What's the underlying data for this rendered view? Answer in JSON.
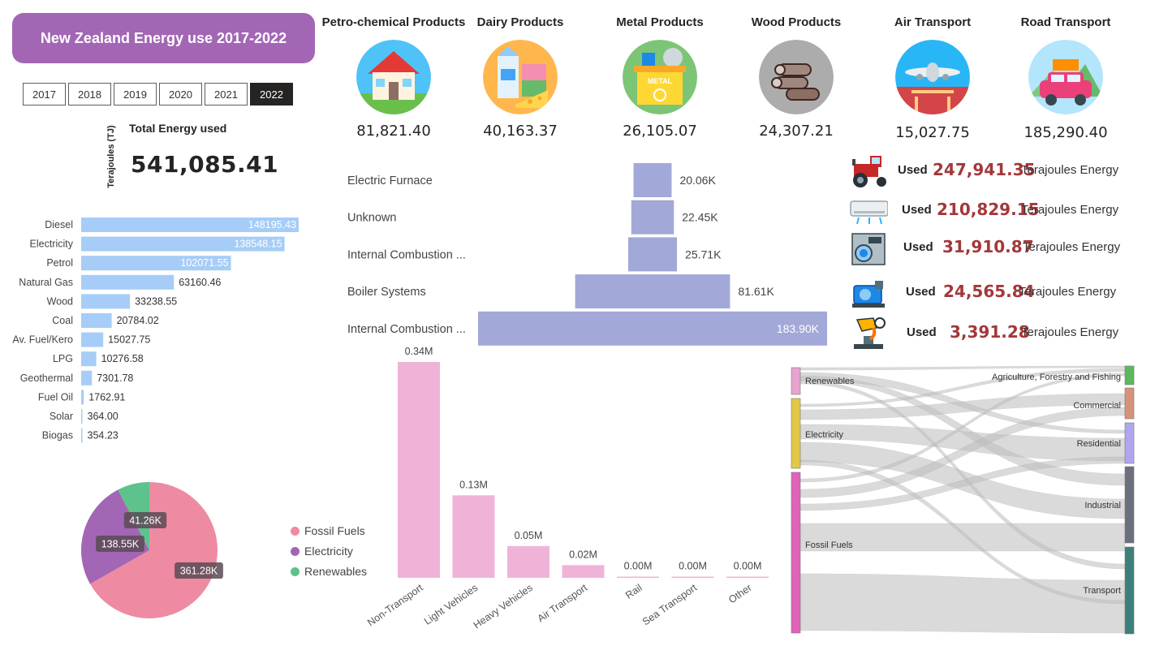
{
  "header": {
    "title": "New Zealand Energy use 2017-2022"
  },
  "years": {
    "items": [
      "2017",
      "2018",
      "2019",
      "2020",
      "2021",
      "2022"
    ],
    "selected": "2022"
  },
  "kpi": {
    "axis_label": "Terajoules (TJ)",
    "title": "Total Energy used",
    "value": "541,085.41"
  },
  "products": [
    {
      "title": "Petro-chemical Products",
      "value": "81,821.40",
      "icon": "house-icon"
    },
    {
      "title": "Dairy Products",
      "value": "40,163.37",
      "icon": "milk-cheese-icon"
    },
    {
      "title": "Metal Products",
      "value": "26,105.07",
      "icon": "metal-recycle-bin-icon"
    },
    {
      "title": "Wood Products",
      "value": "24,307.21",
      "icon": "logs-icon"
    },
    {
      "title": "Air Transport",
      "value": "15,027.75",
      "icon": "airplane-icon"
    },
    {
      "title": "Road Transport",
      "value": "185,290.40",
      "icon": "car-icon"
    }
  ],
  "used": [
    {
      "label": "Used",
      "value": "247,941.35",
      "tail": "Terajoules Energy",
      "icon": "tractor-icon"
    },
    {
      "label": "Used",
      "value": "210,829.15",
      "tail": "Terajoules Energy",
      "icon": "air-conditioner-icon"
    },
    {
      "label": "Used",
      "value": "31,910.87",
      "tail": "Terajoules Energy",
      "icon": "washing-machine-icon"
    },
    {
      "label": "Used",
      "value": "24,565.84",
      "tail": "Terajoules Energy",
      "icon": "generator-icon"
    },
    {
      "label": "Used",
      "value": "3,391.28",
      "tail": "Terajoules Energy",
      "icon": "smelting-icon"
    }
  ],
  "colors": {
    "title_bg": "#a366b5",
    "fuel_bar": "#a6cdf7",
    "funnel": "#a2a9d8",
    "column": "#f0b3d8",
    "fossil": "#ef8aa3",
    "electricity": "#a366b5",
    "renewables": "#5dc28b",
    "used_value": "#a4373a"
  },
  "chart_data": [
    {
      "type": "bar",
      "orientation": "horizontal",
      "categories": [
        "Diesel",
        "Electricity",
        "Petrol",
        "Natural Gas",
        "Wood",
        "Coal",
        "Av. Fuel/Kero",
        "LPG",
        "Geothermal",
        "Fuel Oil",
        "Solar",
        "Biogas"
      ],
      "values": [
        148195.43,
        138548.15,
        102071.55,
        63160.46,
        33238.55,
        20784.02,
        15027.75,
        10276.58,
        7301.78,
        1762.91,
        364.0,
        354.23
      ],
      "labels": [
        "148195.43",
        "138548.15",
        "102071.55",
        "63160.46",
        "33238.55",
        "20784.02",
        "15027.75",
        "10276.58",
        "7301.78",
        "1762.91",
        "364.00",
        "354.23"
      ],
      "xlim": [
        0,
        148195.43
      ]
    },
    {
      "type": "bar",
      "orientation": "funnel",
      "categories": [
        "Electric Furnace",
        "Unknown",
        "Internal Combustion ...",
        "Boiler Systems",
        "Internal Combustion ..."
      ],
      "values": [
        20060,
        22450,
        25710,
        81610,
        183900
      ],
      "labels": [
        "20.06K",
        "22.45K",
        "25.71K",
        "81.61K",
        "183.90K"
      ]
    },
    {
      "type": "bar",
      "categories": [
        "Non-Transport",
        "Light Vehicles",
        "Heavy Vehicles",
        "Air Transport",
        "Rail",
        "Sea Transport",
        "Other"
      ],
      "values": [
        340000,
        130000,
        50000,
        20000,
        0,
        0,
        0
      ],
      "labels": [
        "0.34M",
        "0.13M",
        "0.05M",
        "0.02M",
        "0.00M",
        "0.00M",
        "0.00M"
      ],
      "ylim": [
        0,
        340000
      ]
    },
    {
      "type": "pie",
      "categories": [
        "Fossil Fuels",
        "Electricity",
        "Renewables"
      ],
      "values": [
        361280,
        138550,
        41260
      ],
      "labels": [
        "361.28K",
        "138.55K",
        "41.26K"
      ],
      "legend": "right"
    },
    {
      "type": "sankey",
      "sources": [
        "Renewables",
        "Electricity",
        "Fossil Fuels"
      ],
      "targets": [
        "Agriculture, Forestry and Fishing",
        "Commercial",
        "Residential",
        "Industrial",
        "Transport"
      ]
    }
  ]
}
